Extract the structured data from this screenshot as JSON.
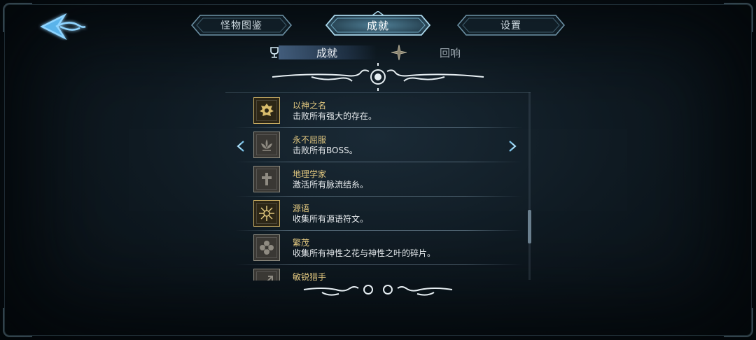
{
  "tabs": [
    {
      "label": "怪物图鉴",
      "active": false
    },
    {
      "label": "成就",
      "active": true
    },
    {
      "label": "设置",
      "active": false
    }
  ],
  "subtabs": {
    "achievements": "成就",
    "echo": "回响"
  },
  "achievements": [
    {
      "title": "以神之名",
      "desc": "击败所有强大的存在。",
      "unlocked": true,
      "icon": "lion-crest-icon"
    },
    {
      "title": "永不屈服",
      "desc": "击败所有BOSS。",
      "unlocked": false,
      "icon": "lotus-icon"
    },
    {
      "title": "地理学家",
      "desc": "激活所有脉流结糸。",
      "unlocked": false,
      "icon": "pylon-icon"
    },
    {
      "title": "源语",
      "desc": "收集所有源语符文。",
      "unlocked": true,
      "icon": "sun-rune-icon"
    },
    {
      "title": "繁茂",
      "desc": "收集所有神性之花与神性之叶的碎片。",
      "unlocked": false,
      "icon": "flower-icon"
    },
    {
      "title": "敏锐猎手",
      "desc": "",
      "unlocked": false,
      "icon": "hunter-icon"
    }
  ],
  "colors": {
    "accent": "#6fb3e0",
    "gold": "#e2c880",
    "panel": "#0f1a22"
  }
}
